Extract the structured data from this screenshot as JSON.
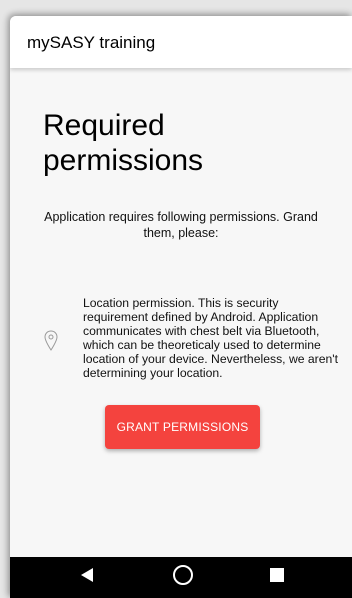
{
  "app_bar": {
    "title": "mySASY training"
  },
  "main": {
    "heading": "Required permissions",
    "intro": "Application requires following permissions. Grand them, please:",
    "permissions": [
      {
        "icon": "location-pin-icon",
        "text": "Location permission. This is security requirement defined by Android. Application communicates with chest belt via Bluetooth, which can be theoreticaly used to determine location of your device. Nevertheless, we aren't determining your location."
      }
    ],
    "grant_button_label": "GRANT PERMISSIONS"
  },
  "nav_bar": {
    "buttons": [
      "back-icon",
      "home-icon",
      "recents-icon"
    ]
  },
  "colors": {
    "accent": "#f4433e",
    "nav_background": "#000000",
    "content_background": "#f7f7f7"
  }
}
